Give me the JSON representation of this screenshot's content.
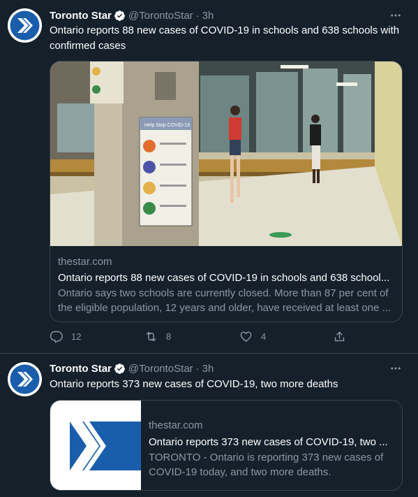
{
  "tweets": [
    {
      "author_name": "Toronto Star",
      "author_handle": "@TorontoStar",
      "separator": "·",
      "time": "3h",
      "text": "Ontario reports 88 new cases of COVID-19 in schools and 638 schools with confirmed cases",
      "card": {
        "domain": "thestar.com",
        "title": "Ontario reports 88 new cases of COVID-19 in schools and 638 school...",
        "description": "Ontario says two schools are currently closed. More than 87 per cent of the eligible population, 12 years and older, have received at least one ...",
        "image_poster_title": "Help Stop COVID-19"
      },
      "actions": {
        "replies": "12",
        "retweets": "8",
        "likes": "4"
      }
    },
    {
      "author_name": "Toronto Star",
      "author_handle": "@TorontoStar",
      "separator": "·",
      "time": "3h",
      "text": "Ontario reports 373 new cases of COVID-19, two more deaths",
      "card": {
        "domain": "thestar.com",
        "title": "Ontario reports 373 new cases of COVID-19, two ...",
        "description": "TORONTO - Ontario is reporting 373 new cases of COVID-19 today, and two more deaths."
      }
    }
  ],
  "colors": {
    "background": "#15202b",
    "border": "#38444d",
    "secondary_text": "#8b98a5",
    "verified_badge": "#ffffff",
    "brand_blue": "#1a5eab"
  },
  "icons": {
    "avatar": "toronto-star-logo",
    "verified": "verified-badge-icon",
    "more": "more-horizontal-icon",
    "reply": "reply-icon",
    "retweet": "retweet-icon",
    "like": "heart-icon",
    "share": "share-icon"
  }
}
